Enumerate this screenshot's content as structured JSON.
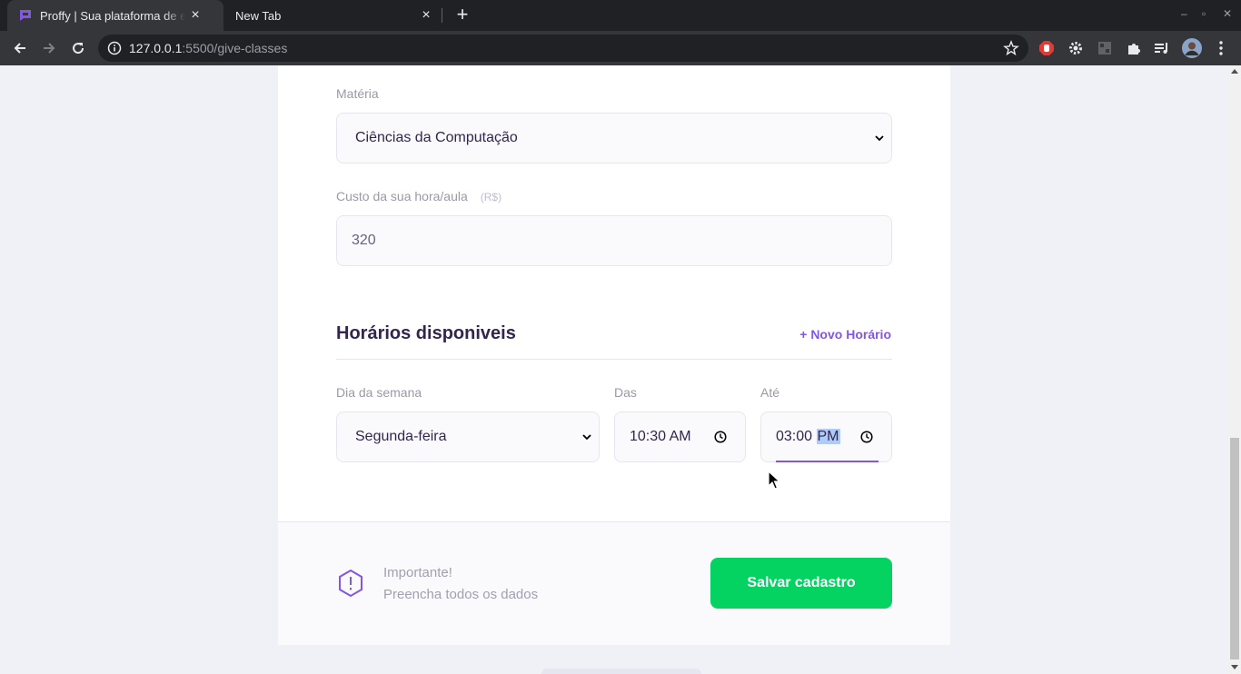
{
  "browser": {
    "tabs": [
      {
        "title": "Proffy | Sua plataforma de estudos online",
        "active": true
      },
      {
        "title": "New Tab",
        "active": false
      }
    ],
    "url_host": "127.0.0.1",
    "url_rest": ":5500/give-classes"
  },
  "form": {
    "subject": {
      "label": "Matéria",
      "value": "Ciências da Computação"
    },
    "cost": {
      "label": "Custo da sua hora/aula",
      "hint": "(R$)",
      "value": "320"
    }
  },
  "schedule": {
    "title": "Horários disponiveis",
    "add_label": "+ Novo Horário",
    "weekday": {
      "label": "Dia da semana",
      "value": "Segunda-feira"
    },
    "from": {
      "label": "Das",
      "value": "10:30 AM"
    },
    "to": {
      "label": "Até",
      "time": "03:00",
      "period": "PM"
    }
  },
  "footer": {
    "warning_title": "Importante!",
    "warning_text": "Preencha todos os dados",
    "save_label": "Salvar cadastro"
  },
  "colors": {
    "accent": "#8257e5",
    "save": "#04d361",
    "title": "#32264d"
  }
}
